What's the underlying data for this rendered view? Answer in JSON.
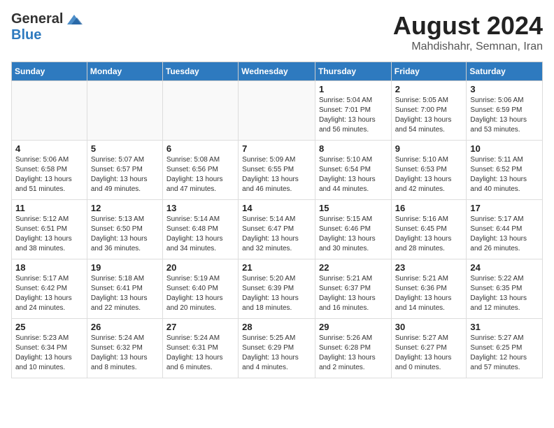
{
  "logo": {
    "general": "General",
    "blue": "Blue"
  },
  "title": {
    "month_year": "August 2024",
    "location": "Mahdishahr, Semnan, Iran"
  },
  "days_of_week": [
    "Sunday",
    "Monday",
    "Tuesday",
    "Wednesday",
    "Thursday",
    "Friday",
    "Saturday"
  ],
  "weeks": [
    [
      {
        "day": "",
        "info": ""
      },
      {
        "day": "",
        "info": ""
      },
      {
        "day": "",
        "info": ""
      },
      {
        "day": "",
        "info": ""
      },
      {
        "day": "1",
        "info": "Sunrise: 5:04 AM\nSunset: 7:01 PM\nDaylight: 13 hours and 56 minutes."
      },
      {
        "day": "2",
        "info": "Sunrise: 5:05 AM\nSunset: 7:00 PM\nDaylight: 13 hours and 54 minutes."
      },
      {
        "day": "3",
        "info": "Sunrise: 5:06 AM\nSunset: 6:59 PM\nDaylight: 13 hours and 53 minutes."
      }
    ],
    [
      {
        "day": "4",
        "info": "Sunrise: 5:06 AM\nSunset: 6:58 PM\nDaylight: 13 hours and 51 minutes."
      },
      {
        "day": "5",
        "info": "Sunrise: 5:07 AM\nSunset: 6:57 PM\nDaylight: 13 hours and 49 minutes."
      },
      {
        "day": "6",
        "info": "Sunrise: 5:08 AM\nSunset: 6:56 PM\nDaylight: 13 hours and 47 minutes."
      },
      {
        "day": "7",
        "info": "Sunrise: 5:09 AM\nSunset: 6:55 PM\nDaylight: 13 hours and 46 minutes."
      },
      {
        "day": "8",
        "info": "Sunrise: 5:10 AM\nSunset: 6:54 PM\nDaylight: 13 hours and 44 minutes."
      },
      {
        "day": "9",
        "info": "Sunrise: 5:10 AM\nSunset: 6:53 PM\nDaylight: 13 hours and 42 minutes."
      },
      {
        "day": "10",
        "info": "Sunrise: 5:11 AM\nSunset: 6:52 PM\nDaylight: 13 hours and 40 minutes."
      }
    ],
    [
      {
        "day": "11",
        "info": "Sunrise: 5:12 AM\nSunset: 6:51 PM\nDaylight: 13 hours and 38 minutes."
      },
      {
        "day": "12",
        "info": "Sunrise: 5:13 AM\nSunset: 6:50 PM\nDaylight: 13 hours and 36 minutes."
      },
      {
        "day": "13",
        "info": "Sunrise: 5:14 AM\nSunset: 6:48 PM\nDaylight: 13 hours and 34 minutes."
      },
      {
        "day": "14",
        "info": "Sunrise: 5:14 AM\nSunset: 6:47 PM\nDaylight: 13 hours and 32 minutes."
      },
      {
        "day": "15",
        "info": "Sunrise: 5:15 AM\nSunset: 6:46 PM\nDaylight: 13 hours and 30 minutes."
      },
      {
        "day": "16",
        "info": "Sunrise: 5:16 AM\nSunset: 6:45 PM\nDaylight: 13 hours and 28 minutes."
      },
      {
        "day": "17",
        "info": "Sunrise: 5:17 AM\nSunset: 6:44 PM\nDaylight: 13 hours and 26 minutes."
      }
    ],
    [
      {
        "day": "18",
        "info": "Sunrise: 5:17 AM\nSunset: 6:42 PM\nDaylight: 13 hours and 24 minutes."
      },
      {
        "day": "19",
        "info": "Sunrise: 5:18 AM\nSunset: 6:41 PM\nDaylight: 13 hours and 22 minutes."
      },
      {
        "day": "20",
        "info": "Sunrise: 5:19 AM\nSunset: 6:40 PM\nDaylight: 13 hours and 20 minutes."
      },
      {
        "day": "21",
        "info": "Sunrise: 5:20 AM\nSunset: 6:39 PM\nDaylight: 13 hours and 18 minutes."
      },
      {
        "day": "22",
        "info": "Sunrise: 5:21 AM\nSunset: 6:37 PM\nDaylight: 13 hours and 16 minutes."
      },
      {
        "day": "23",
        "info": "Sunrise: 5:21 AM\nSunset: 6:36 PM\nDaylight: 13 hours and 14 minutes."
      },
      {
        "day": "24",
        "info": "Sunrise: 5:22 AM\nSunset: 6:35 PM\nDaylight: 13 hours and 12 minutes."
      }
    ],
    [
      {
        "day": "25",
        "info": "Sunrise: 5:23 AM\nSunset: 6:34 PM\nDaylight: 13 hours and 10 minutes."
      },
      {
        "day": "26",
        "info": "Sunrise: 5:24 AM\nSunset: 6:32 PM\nDaylight: 13 hours and 8 minutes."
      },
      {
        "day": "27",
        "info": "Sunrise: 5:24 AM\nSunset: 6:31 PM\nDaylight: 13 hours and 6 minutes."
      },
      {
        "day": "28",
        "info": "Sunrise: 5:25 AM\nSunset: 6:29 PM\nDaylight: 13 hours and 4 minutes."
      },
      {
        "day": "29",
        "info": "Sunrise: 5:26 AM\nSunset: 6:28 PM\nDaylight: 13 hours and 2 minutes."
      },
      {
        "day": "30",
        "info": "Sunrise: 5:27 AM\nSunset: 6:27 PM\nDaylight: 13 hours and 0 minutes."
      },
      {
        "day": "31",
        "info": "Sunrise: 5:27 AM\nSunset: 6:25 PM\nDaylight: 12 hours and 57 minutes."
      }
    ]
  ]
}
